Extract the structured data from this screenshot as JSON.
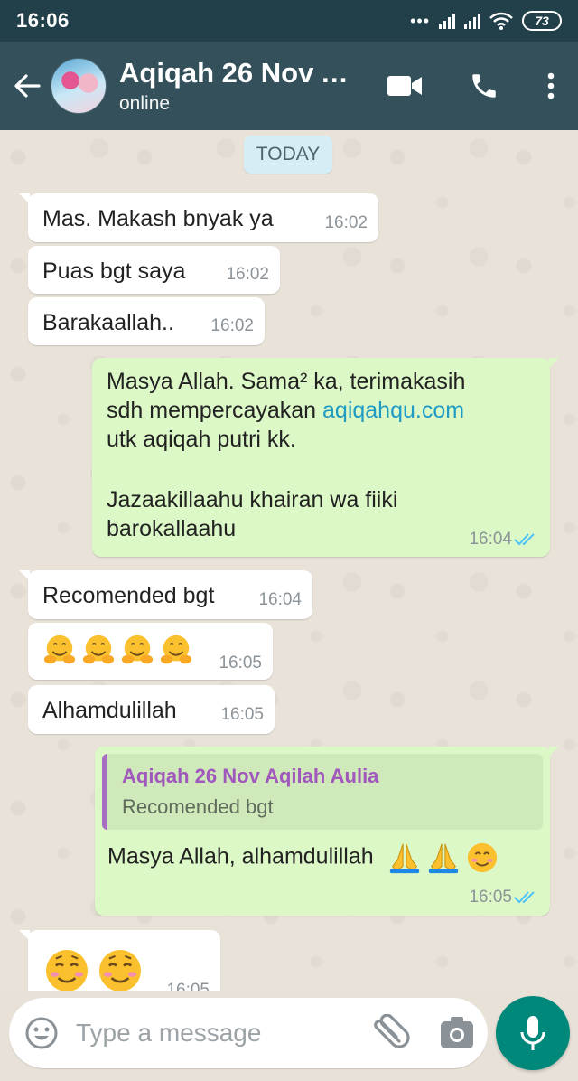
{
  "status_bar": {
    "time": "16:06",
    "battery": "73",
    "icons": [
      "more-dots-icon",
      "signal-icon",
      "signal-icon",
      "wifi-icon",
      "battery-icon"
    ]
  },
  "header": {
    "title": "Aqiqah 26 Nov A...",
    "subtitle": "online",
    "icons": [
      "back-arrow-icon",
      "video-call-icon",
      "phone-icon",
      "more-vertical-icon"
    ]
  },
  "chat": {
    "day_label": "TODAY",
    "messages": [
      {
        "dir": "in",
        "text": "Mas. Makash bnyak ya",
        "time": "16:02"
      },
      {
        "dir": "in",
        "text": "Puas bgt saya",
        "time": "16:02"
      },
      {
        "dir": "in",
        "text": "Barakaallah..",
        "time": "16:02"
      },
      {
        "dir": "out",
        "line1": "Masya Allah. Sama² ka, terimakasih",
        "line2_prefix": "sdh mempercayakan ",
        "link": "aqiqahqu.com",
        "line3": "utk aqiqah putri kk.",
        "line4": "Jazaakillaahu khairan wa fiiki",
        "line5": "barokallaahu",
        "time": "16:04",
        "status": "read"
      },
      {
        "dir": "in",
        "text": "Recomended bgt",
        "time": "16:04"
      },
      {
        "dir": "in",
        "emoji": [
          "hugging-face",
          "hugging-face",
          "hugging-face",
          "hugging-face"
        ],
        "time": "16:05"
      },
      {
        "dir": "in",
        "text": "Alhamdulillah",
        "time": "16:05"
      },
      {
        "dir": "out",
        "quote_name": "Aqiqah 26 Nov Aqilah Aulia",
        "quote_text": "Recomended bgt",
        "text": "Masya Allah, alhamdulillah",
        "emoji": [
          "folded-hands",
          "folded-hands",
          "smiling-face"
        ],
        "time": "16:05",
        "status": "read"
      },
      {
        "dir": "in",
        "emoji": [
          "relieved-smiling-face",
          "relieved-smiling-face"
        ],
        "time": "16:05"
      }
    ]
  },
  "composer": {
    "placeholder": "Type a message",
    "icons": [
      "emoji-icon",
      "attach-icon",
      "camera-icon",
      "mic-icon"
    ]
  },
  "colors": {
    "app_bar": "#34505a",
    "status_bar": "#22404a",
    "outgoing_bubble": "#dcf8c6",
    "incoming_bubble": "#ffffff",
    "read_ticks": "#4fc3f7",
    "link": "#1f9bc4",
    "quote_author": "#a058bd",
    "mic_button": "#00897b"
  }
}
